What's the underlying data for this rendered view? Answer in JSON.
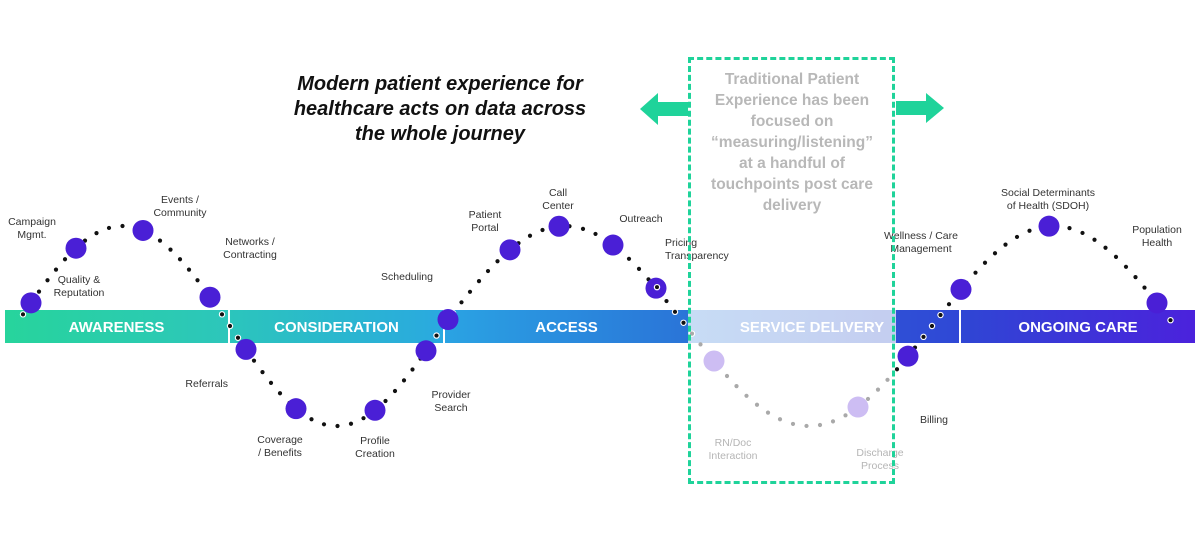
{
  "headline": {
    "lines": [
      "Modern patient experience for",
      "healthcare acts on data across",
      "the whole journey"
    ]
  },
  "callout": {
    "lines": [
      "Traditional Patient",
      "Experience has been",
      "focused on",
      "“measuring/listening”",
      "at a handful of",
      "touchpoints post care",
      "delivery"
    ],
    "border_color": "#1fd39a",
    "arrows": [
      "arrow-left-icon",
      "arrow-right-icon"
    ]
  },
  "stages": [
    {
      "label": "AWARENESS",
      "color_start": "#27d49c",
      "color_end": "#2dc6bb"
    },
    {
      "label": "CONSIDERATION",
      "color_start": "#2bc5bc",
      "color_end": "#2aa9e0"
    },
    {
      "label": "ACCESS",
      "color_start": "#2aa3e3",
      "color_end": "#2a74d8"
    },
    {
      "label": "SERVICE DELIVERY",
      "color_start": "#c7dcf5",
      "color_end": "#c4cdf0",
      "faded": true
    },
    {
      "label": "",
      "color_start": "#2f4fd6",
      "color_end": "#2f48d6"
    },
    {
      "label": "ONGOING CARE",
      "color_start": "#2f46d4",
      "color_end": "#4b22dc"
    }
  ],
  "touchpoints": [
    {
      "id": "quality-reputation",
      "lines": [
        "Quality &",
        "Reputation"
      ],
      "faded": false
    },
    {
      "id": "campaign-mgmt",
      "lines": [
        "Campaign",
        "Mgmt."
      ],
      "faded": false
    },
    {
      "id": "events-community",
      "lines": [
        "Events /",
        "Community"
      ],
      "faded": false
    },
    {
      "id": "networks-contracting",
      "lines": [
        "Networks /",
        "Contracting"
      ],
      "faded": false
    },
    {
      "id": "referrals",
      "lines": [
        "Referrals"
      ],
      "faded": false
    },
    {
      "id": "coverage-benefits",
      "lines": [
        "Coverage",
        "/ Benefits"
      ],
      "faded": false
    },
    {
      "id": "profile-creation",
      "lines": [
        "Profile",
        "Creation"
      ],
      "faded": false
    },
    {
      "id": "provider-search",
      "lines": [
        "Provider",
        "Search"
      ],
      "faded": false
    },
    {
      "id": "scheduling",
      "lines": [
        "Scheduling"
      ],
      "faded": false
    },
    {
      "id": "patient-portal",
      "lines": [
        "Patient",
        "Portal"
      ],
      "faded": false
    },
    {
      "id": "call-center",
      "lines": [
        "Call",
        "Center"
      ],
      "faded": false
    },
    {
      "id": "outreach",
      "lines": [
        "Outreach"
      ],
      "faded": false
    },
    {
      "id": "pricing-transparency",
      "lines": [
        "Pricing",
        "Transparency"
      ],
      "faded": false
    },
    {
      "id": "rn-doc-interaction",
      "lines": [
        "RN/Doc",
        "Interaction"
      ],
      "faded": true
    },
    {
      "id": "discharge-process",
      "lines": [
        "Discharge",
        "Process"
      ],
      "faded": true
    },
    {
      "id": "billing",
      "lines": [
        "Billing"
      ],
      "faded": false
    },
    {
      "id": "wellness-care-management",
      "lines": [
        "Wellness / Care",
        "Management"
      ],
      "faded": false
    },
    {
      "id": "sdoh",
      "lines": [
        "Social Determinants",
        "of Health (SDOH)"
      ],
      "faded": false
    },
    {
      "id": "population-health",
      "lines": [
        "Population",
        "Health"
      ],
      "faded": false
    }
  ],
  "colors": {
    "node": "#4a1fd6",
    "node_faded": "#cdbdf3",
    "dot": "#111111",
    "dot_faded": "#a9a9a9",
    "accent": "#1fd39a"
  }
}
